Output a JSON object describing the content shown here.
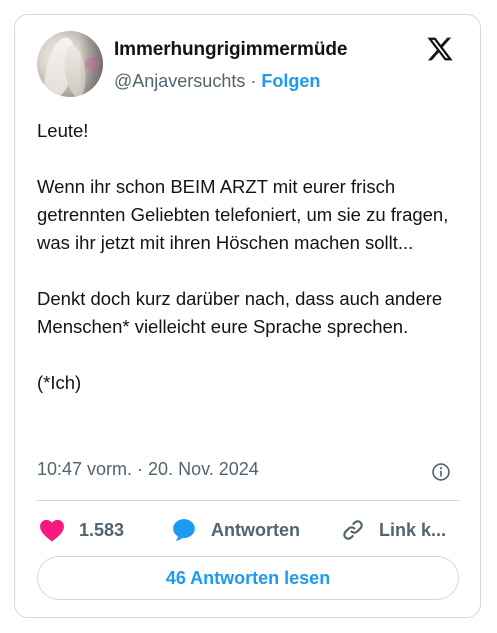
{
  "user": {
    "display_name": "Immerhungrigimmermüde",
    "handle": "@Anjaversuchts",
    "separator": "·",
    "follow_label": "Folgen"
  },
  "post": {
    "text": "Leute!\n\nWenn ihr schon BEIM ARZT mit eurer frisch getrennten Geliebten telefoniert, um sie zu fragen, was ihr jetzt mit ihren Höschen machen sollt...\n\nDenkt doch kurz darüber nach, dass auch andere Menschen* vielleicht eure Sprache sprechen.\n\n(*Ich)",
    "timestamp": "10:47 vorm. · 20. Nov. 2024"
  },
  "actions": {
    "like_count": "1.583",
    "reply_label": "Antworten",
    "link_label": "Link k..."
  },
  "read_replies_label": "46 Antworten lesen",
  "icons": {
    "platform": "x-logo-icon",
    "info": "info-icon",
    "like": "heart-icon",
    "reply": "speech-bubble-icon",
    "link": "link-icon"
  },
  "colors": {
    "accent": "#1d9bf0",
    "like": "#f91880",
    "text": "#0f1419",
    "secondary": "#536471",
    "border": "#cfd9de"
  }
}
